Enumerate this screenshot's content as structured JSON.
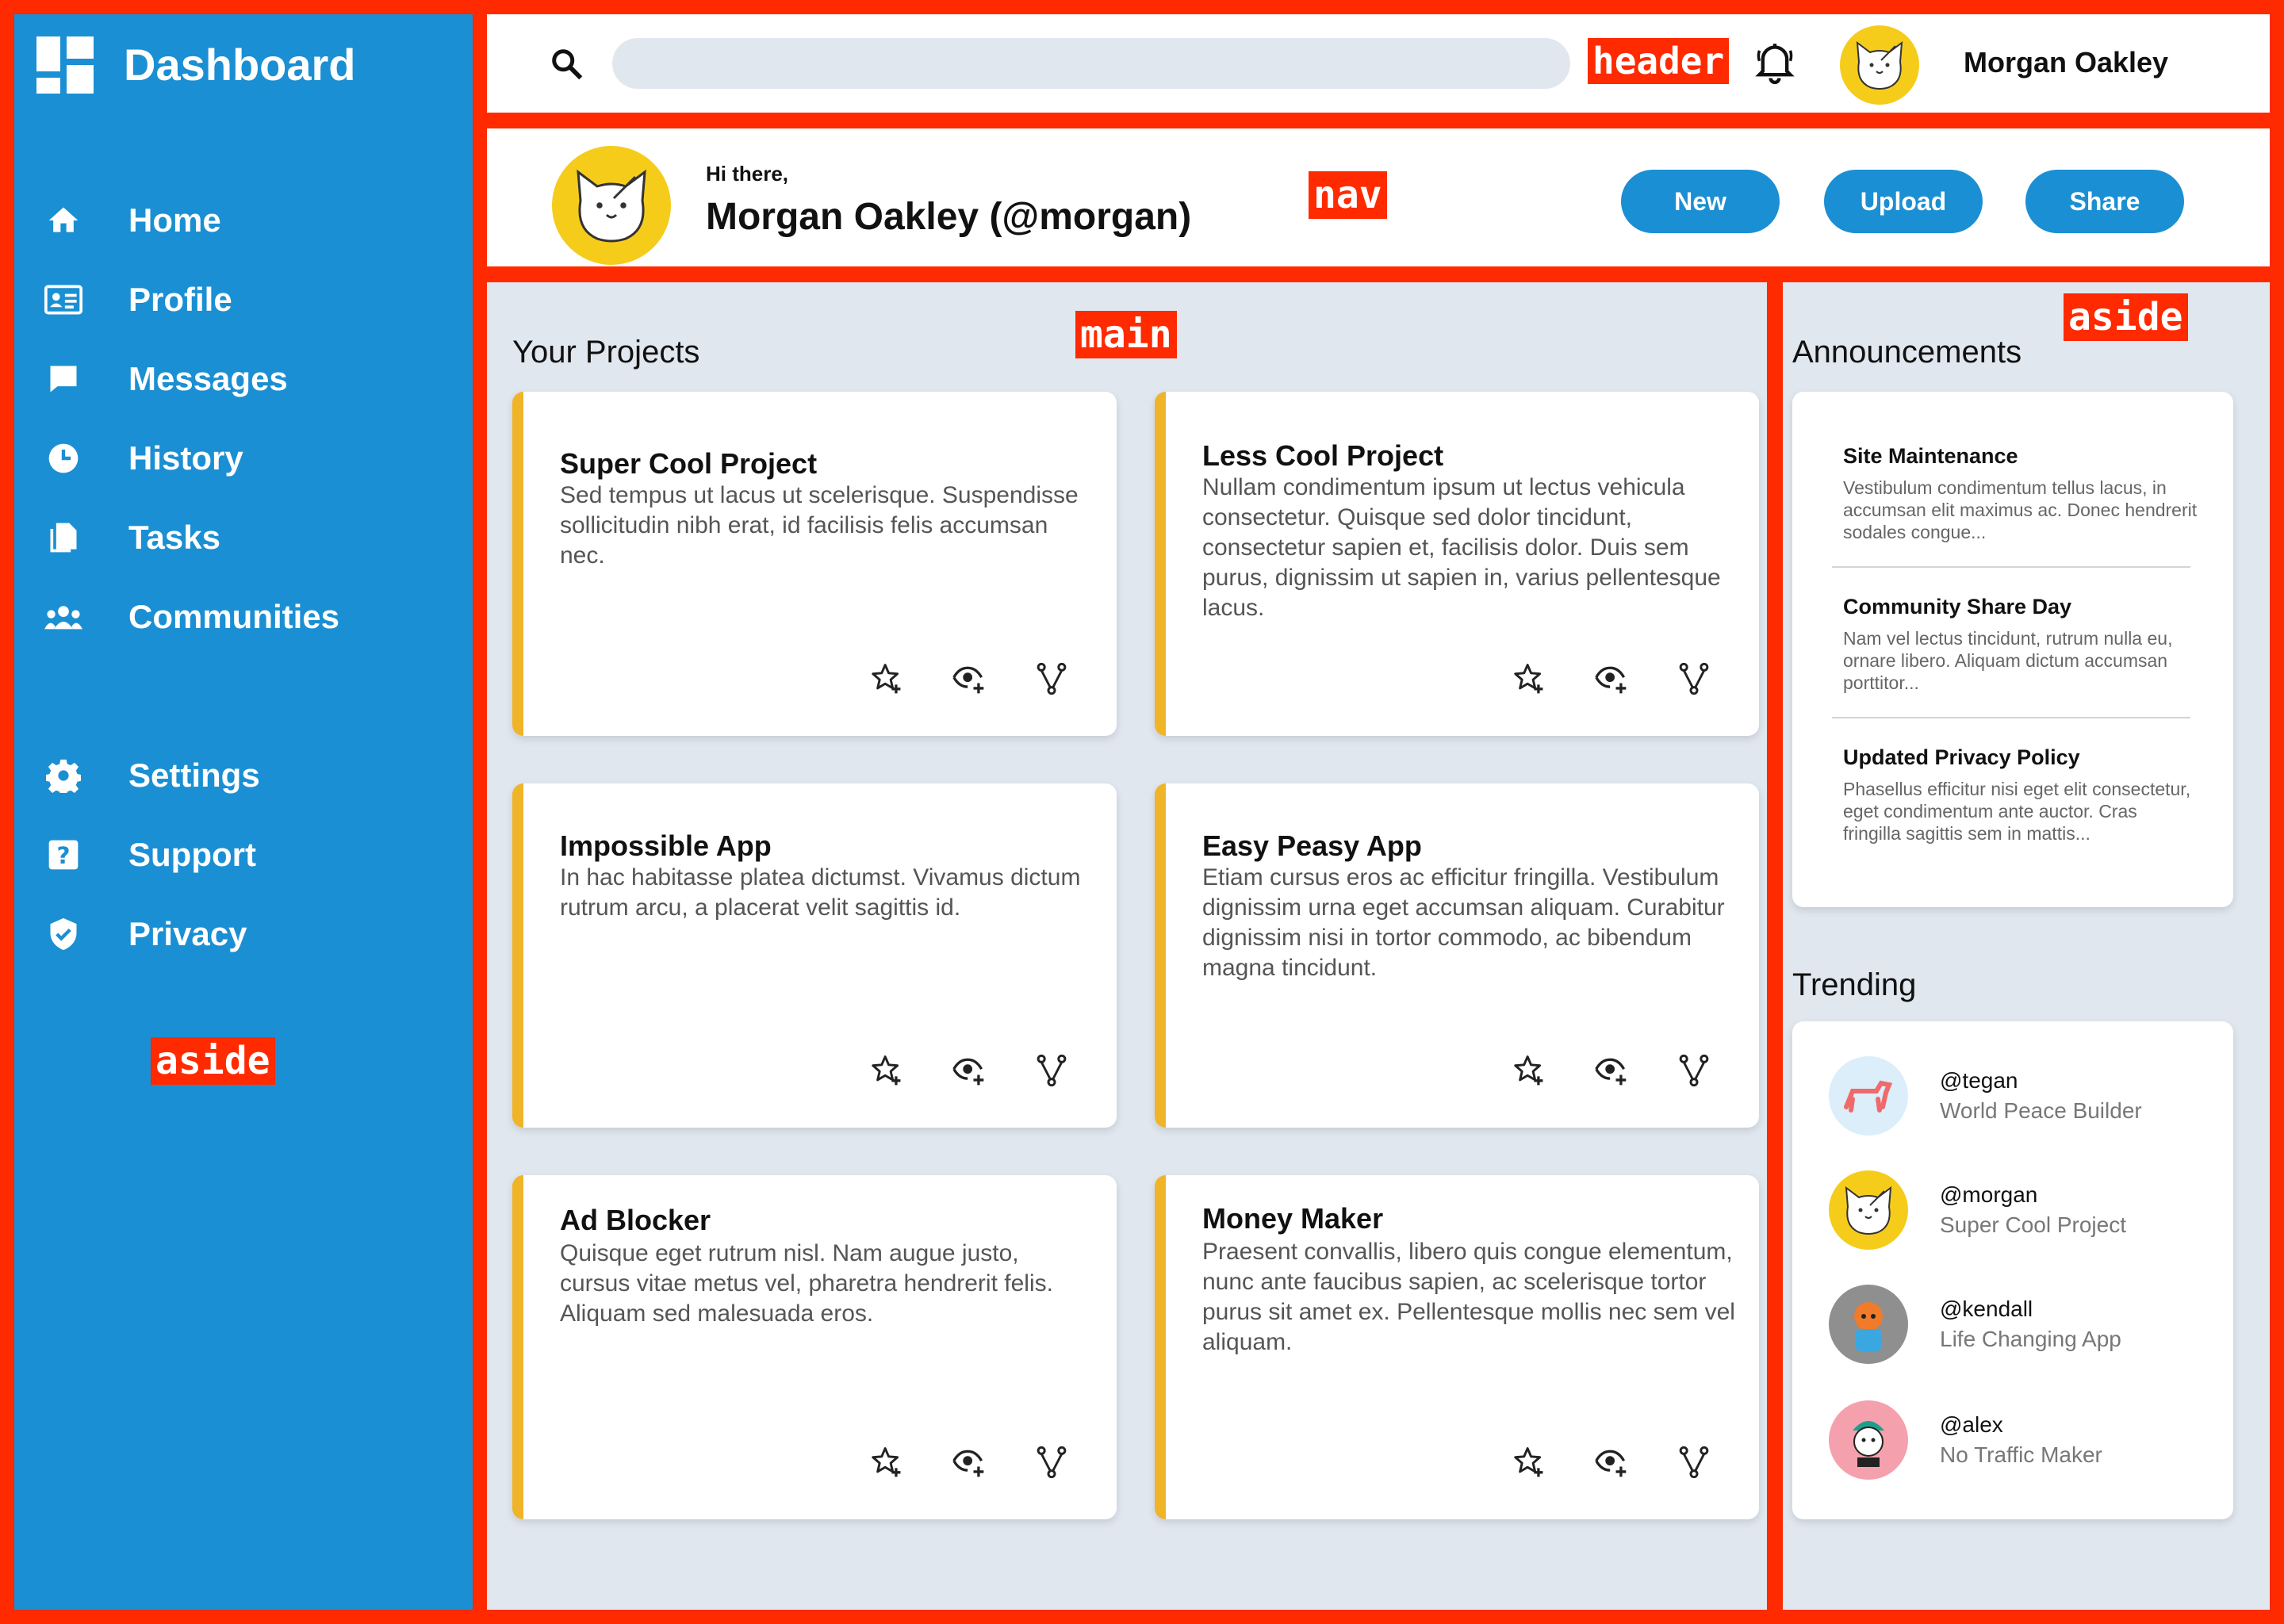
{
  "brand": {
    "title": "Dashboard"
  },
  "sidebar": {
    "items": [
      {
        "label": "Home",
        "icon": "home-icon"
      },
      {
        "label": "Profile",
        "icon": "id-card-icon"
      },
      {
        "label": "Messages",
        "icon": "message-icon"
      },
      {
        "label": "History",
        "icon": "clock-icon"
      },
      {
        "label": "Tasks",
        "icon": "copy-icon"
      },
      {
        "label": "Communities",
        "icon": "group-icon"
      }
    ],
    "secondary": [
      {
        "label": "Settings",
        "icon": "gear-icon"
      },
      {
        "label": "Support",
        "icon": "help-icon"
      },
      {
        "label": "Privacy",
        "icon": "shield-icon"
      }
    ]
  },
  "labels": {
    "aside_left": "aside",
    "header": "header",
    "nav": "nav",
    "main": "main",
    "aside_right": "aside"
  },
  "header": {
    "search": {
      "placeholder": "",
      "value": ""
    },
    "user_name": "Morgan Oakley"
  },
  "greeting": {
    "hi": "Hi there,",
    "name": "Morgan Oakley (@morgan)",
    "buttons": {
      "new": "New",
      "upload": "Upload",
      "share": "Share"
    }
  },
  "main": {
    "title": "Your Projects",
    "projects": [
      {
        "title": "Super Cool Project",
        "desc": "Sed tempus ut lacus ut scelerisque. Suspendisse sollicitudin nibh erat, id facilisis felis accumsan nec."
      },
      {
        "title": "Less Cool Project",
        "desc": "Nullam condimentum ipsum ut lectus vehicula consectetur. Quisque sed dolor tincidunt, consectetur sapien et, facilisis dolor. Duis sem purus, dignissim ut sapien in, varius pellentesque lacus."
      },
      {
        "title": "Impossible App",
        "desc": "In hac habitasse platea dictumst. Vivamus dictum rutrum arcu, a placerat velit sagittis id."
      },
      {
        "title": "Easy Peasy App",
        "desc": "Etiam cursus eros ac efficitur fringilla. Vestibulum dignissim urna eget accumsan aliquam. Curabitur dignissim nisi in tortor commodo, ac bibendum magna tincidunt."
      },
      {
        "title": "Ad Blocker",
        "desc": "Quisque eget rutrum nisl. Nam augue justo, cursus vitae metus vel, pharetra hendrerit felis. Aliquam sed malesuada eros."
      },
      {
        "title": "Money Maker",
        "desc": "Praesent convallis, libero quis congue elementum, nunc ante faucibus sapien, ac scelerisque tortor purus sit amet ex. Pellentesque mollis nec sem vel aliquam."
      }
    ]
  },
  "announcements": {
    "title": "Announcements",
    "items": [
      {
        "title": "Site Maintenance",
        "body": "Vestibulum condimentum tellus lacus, in accumsan elit maximus ac. Donec hendrerit sodales congue..."
      },
      {
        "title": "Community Share Day",
        "body": "Nam vel lectus tincidunt, rutrum nulla eu, ornare libero. Aliquam dictum accumsan porttitor..."
      },
      {
        "title": "Updated Privacy Policy",
        "body": "Phasellus efficitur nisi eget elit consectetur, eget condimentum ante auctor. Cras fringilla sagittis sem in mattis..."
      }
    ]
  },
  "trending": {
    "title": "Trending",
    "items": [
      {
        "handle": "@tegan",
        "project": "World Peace Builder"
      },
      {
        "handle": "@morgan",
        "project": "Super Cool Project"
      },
      {
        "handle": "@kendall",
        "project": "Life Changing App"
      },
      {
        "handle": "@alex",
        "project": "No Traffic Maker"
      }
    ]
  },
  "colors": {
    "sidebar": "#1b8fd3",
    "accent": "#f0b429",
    "background": "#e1e7ef",
    "outline": "#ff2a00"
  }
}
